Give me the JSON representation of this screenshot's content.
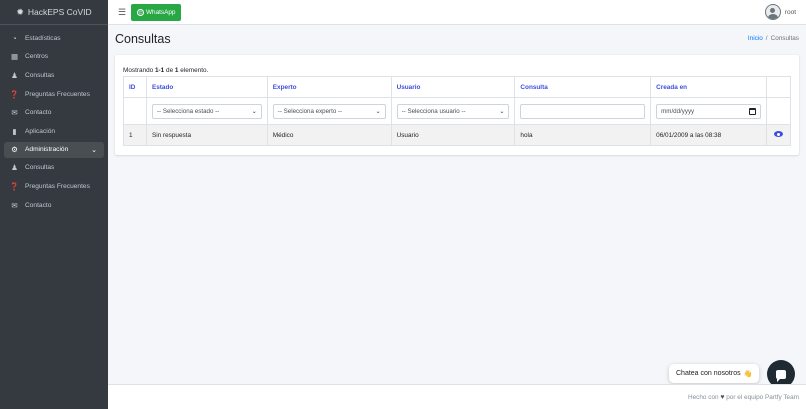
{
  "sidebar": {
    "brand": "HackEPS CoVID",
    "items": [
      {
        "label": "Estadísticas",
        "icon": "dashboard-icon"
      },
      {
        "label": "Centros",
        "icon": "building-icon"
      },
      {
        "label": "Consultas",
        "icon": "user-icon"
      },
      {
        "label": "Preguntas Frecuentes",
        "icon": "question-icon"
      },
      {
        "label": "Contacto",
        "icon": "envelope-icon"
      },
      {
        "label": "Aplicación",
        "icon": "mobile-icon"
      },
      {
        "label": "Administración",
        "icon": "cogs-icon"
      },
      {
        "label": "Consultas",
        "icon": "user-icon"
      },
      {
        "label": "Preguntas Frecuentes",
        "icon": "question-icon"
      },
      {
        "label": "Contacto",
        "icon": "envelope-icon"
      }
    ]
  },
  "topbar": {
    "whatsapp_label": "WhatsApp",
    "user_name": "root"
  },
  "page": {
    "title": "Consultas",
    "breadcrumb": {
      "home": "Inicio",
      "separator": "/",
      "current": "Consultas"
    }
  },
  "summary": {
    "prefix": "Mostrando ",
    "range": "1-1",
    "middle": " de ",
    "total": "1",
    "suffix": " elemento."
  },
  "table": {
    "headers": [
      "ID",
      "Estado",
      "Experto",
      "Usuario",
      "Consulta",
      "Creada en",
      ""
    ],
    "filters": {
      "estado": "-- Selecciona estado --",
      "experto": "-- Selecciona experto --",
      "usuario": "-- Selecciona usuario --",
      "consulta": "",
      "fecha": "mm/dd/yyyy"
    },
    "rows": [
      {
        "id": "1",
        "estado": "Sin respuesta",
        "experto": "Médico",
        "usuario": "Usuario",
        "consulta": "hola",
        "creada": "06/01/2009 a las 08:38"
      }
    ]
  },
  "chat": {
    "label": "Chatea con nosotros",
    "emoji": "👋"
  },
  "footer": {
    "prefix": "Hecho con",
    "suffix": "por el equipo Partfy Team"
  },
  "colors": {
    "sidebar": "#343a40",
    "accent": "#3c4ee0",
    "whatsapp": "#28a745",
    "link": "#007bff"
  }
}
